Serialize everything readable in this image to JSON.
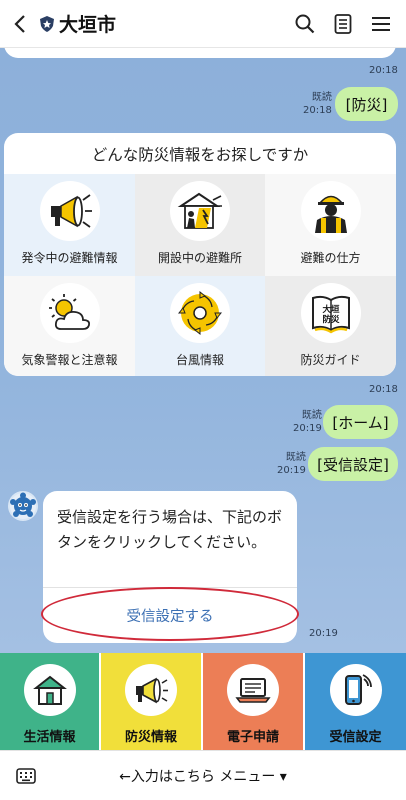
{
  "header": {
    "title": "大垣市",
    "icons": [
      "back-arrow-icon",
      "shield-badge-icon",
      "search-icon",
      "notes-icon",
      "hamburger-menu-icon"
    ]
  },
  "chat": {
    "prev_text": "……",
    "messages": [
      {
        "type": "time",
        "time": "20:18"
      },
      {
        "type": "user",
        "read": "既読",
        "time": "20:18",
        "text": "[防災]"
      },
      {
        "type": "time",
        "time": "20:18"
      },
      {
        "type": "user",
        "read": "既読",
        "time": "20:19",
        "text": "[ホーム]"
      },
      {
        "type": "user",
        "read": "既読",
        "time": "20:19",
        "text": "[受信設定]"
      },
      {
        "type": "time",
        "time": "20:19"
      }
    ],
    "disaster_menu": {
      "title": "どんな防災情報をお探しですか",
      "items": [
        {
          "label": "発令中の避難情報",
          "icon": "megaphone-alert-icon"
        },
        {
          "label": "開設中の避難所",
          "icon": "shelter-icon"
        },
        {
          "label": "避難の仕方",
          "icon": "worker-helmet-icon"
        },
        {
          "label": "気象警報と注意報",
          "icon": "sun-cloud-icon"
        },
        {
          "label": "台風情報",
          "icon": "typhoon-icon"
        },
        {
          "label": "防災ガイド",
          "icon": "guide-book-icon"
        }
      ],
      "book_text": "大垣\n防災"
    },
    "bot": {
      "text": "受信設定を行う場合は、下記のボタンをクリックしてください。",
      "button": "受信設定する"
    }
  },
  "rich_menu": [
    {
      "label": "生活情報",
      "icon": "house-icon",
      "color": "#3fb389"
    },
    {
      "label": "防災情報",
      "icon": "megaphone-icon",
      "color": "#f1df3a"
    },
    {
      "label": "電子申請",
      "icon": "laptop-icon",
      "color": "#ec7e56"
    },
    {
      "label": "受信設定",
      "icon": "phone-signal-icon",
      "color": "#3e96d3"
    }
  ],
  "bottom": {
    "toggle": "←入力はこちら メニュー ▾",
    "icon": "keyboard-icon"
  },
  "colors": {
    "user_bubble": "#c9f1a6",
    "chat_bg": "#8db0da",
    "link": "#3b6fb3",
    "highlight": "#d02a3a"
  }
}
